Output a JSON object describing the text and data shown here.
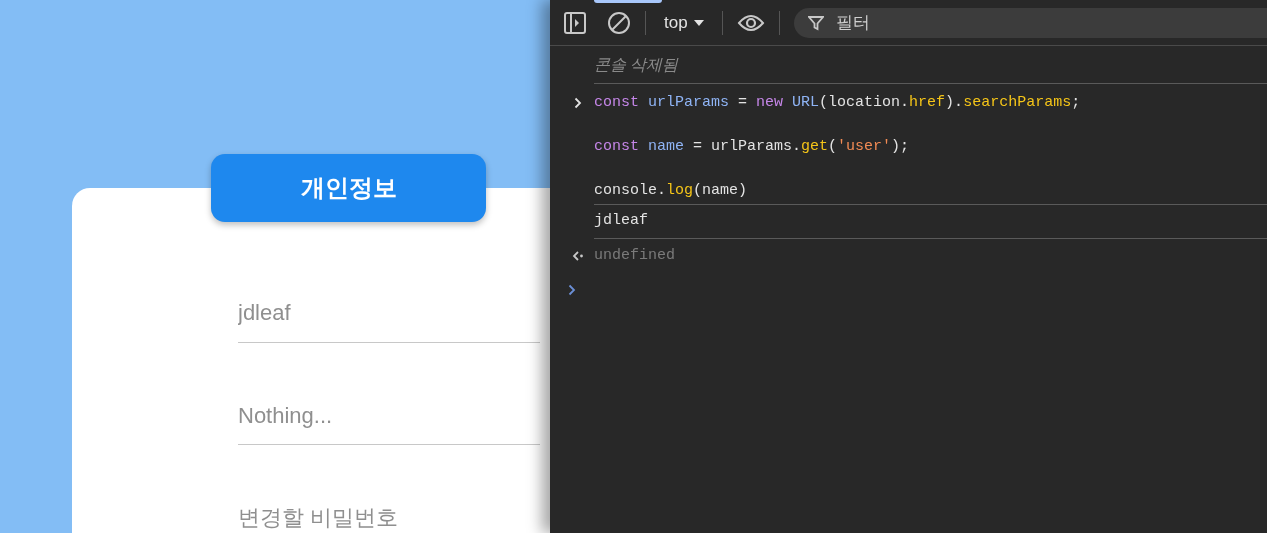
{
  "page": {
    "header": "개인정보",
    "fields": [
      {
        "placeholder": "jdleaf"
      },
      {
        "placeholder": "Nothing..."
      },
      {
        "placeholder": "변경할 비밀번호"
      }
    ]
  },
  "devtools": {
    "context": "top",
    "filter": {
      "placeholder": "필터"
    },
    "console": [
      {
        "kind": "info",
        "text": "콘솔 삭제됨"
      },
      {
        "kind": "input",
        "lines": [
          [
            {
              "kind": "keyword",
              "text": "const "
            },
            {
              "kind": "variable",
              "text": "urlParams"
            },
            {
              "kind": "plain",
              "text": " = "
            },
            {
              "kind": "keyword",
              "text": "new "
            },
            {
              "kind": "variable",
              "text": "URL"
            },
            {
              "kind": "plain",
              "text": "(location."
            },
            {
              "kind": "method",
              "text": "href"
            },
            {
              "kind": "plain",
              "text": ")."
            },
            {
              "kind": "method",
              "text": "searchParams"
            },
            {
              "kind": "plain",
              "text": ";"
            }
          ],
          [
            {
              "kind": "keyword",
              "text": "const "
            },
            {
              "kind": "variable",
              "text": "name"
            },
            {
              "kind": "plain",
              "text": " = urlParams."
            },
            {
              "kind": "method",
              "text": "get"
            },
            {
              "kind": "plain",
              "text": "("
            },
            {
              "kind": "string",
              "text": "'user'"
            },
            {
              "kind": "plain",
              "text": ");"
            }
          ],
          [
            {
              "kind": "plain",
              "text": "console."
            },
            {
              "kind": "method",
              "text": "log"
            },
            {
              "kind": "plain",
              "text": "(name)"
            }
          ]
        ]
      },
      {
        "kind": "output",
        "text": "jdleaf"
      },
      {
        "kind": "result",
        "text": "undefined"
      },
      {
        "kind": "prompt"
      }
    ]
  }
}
